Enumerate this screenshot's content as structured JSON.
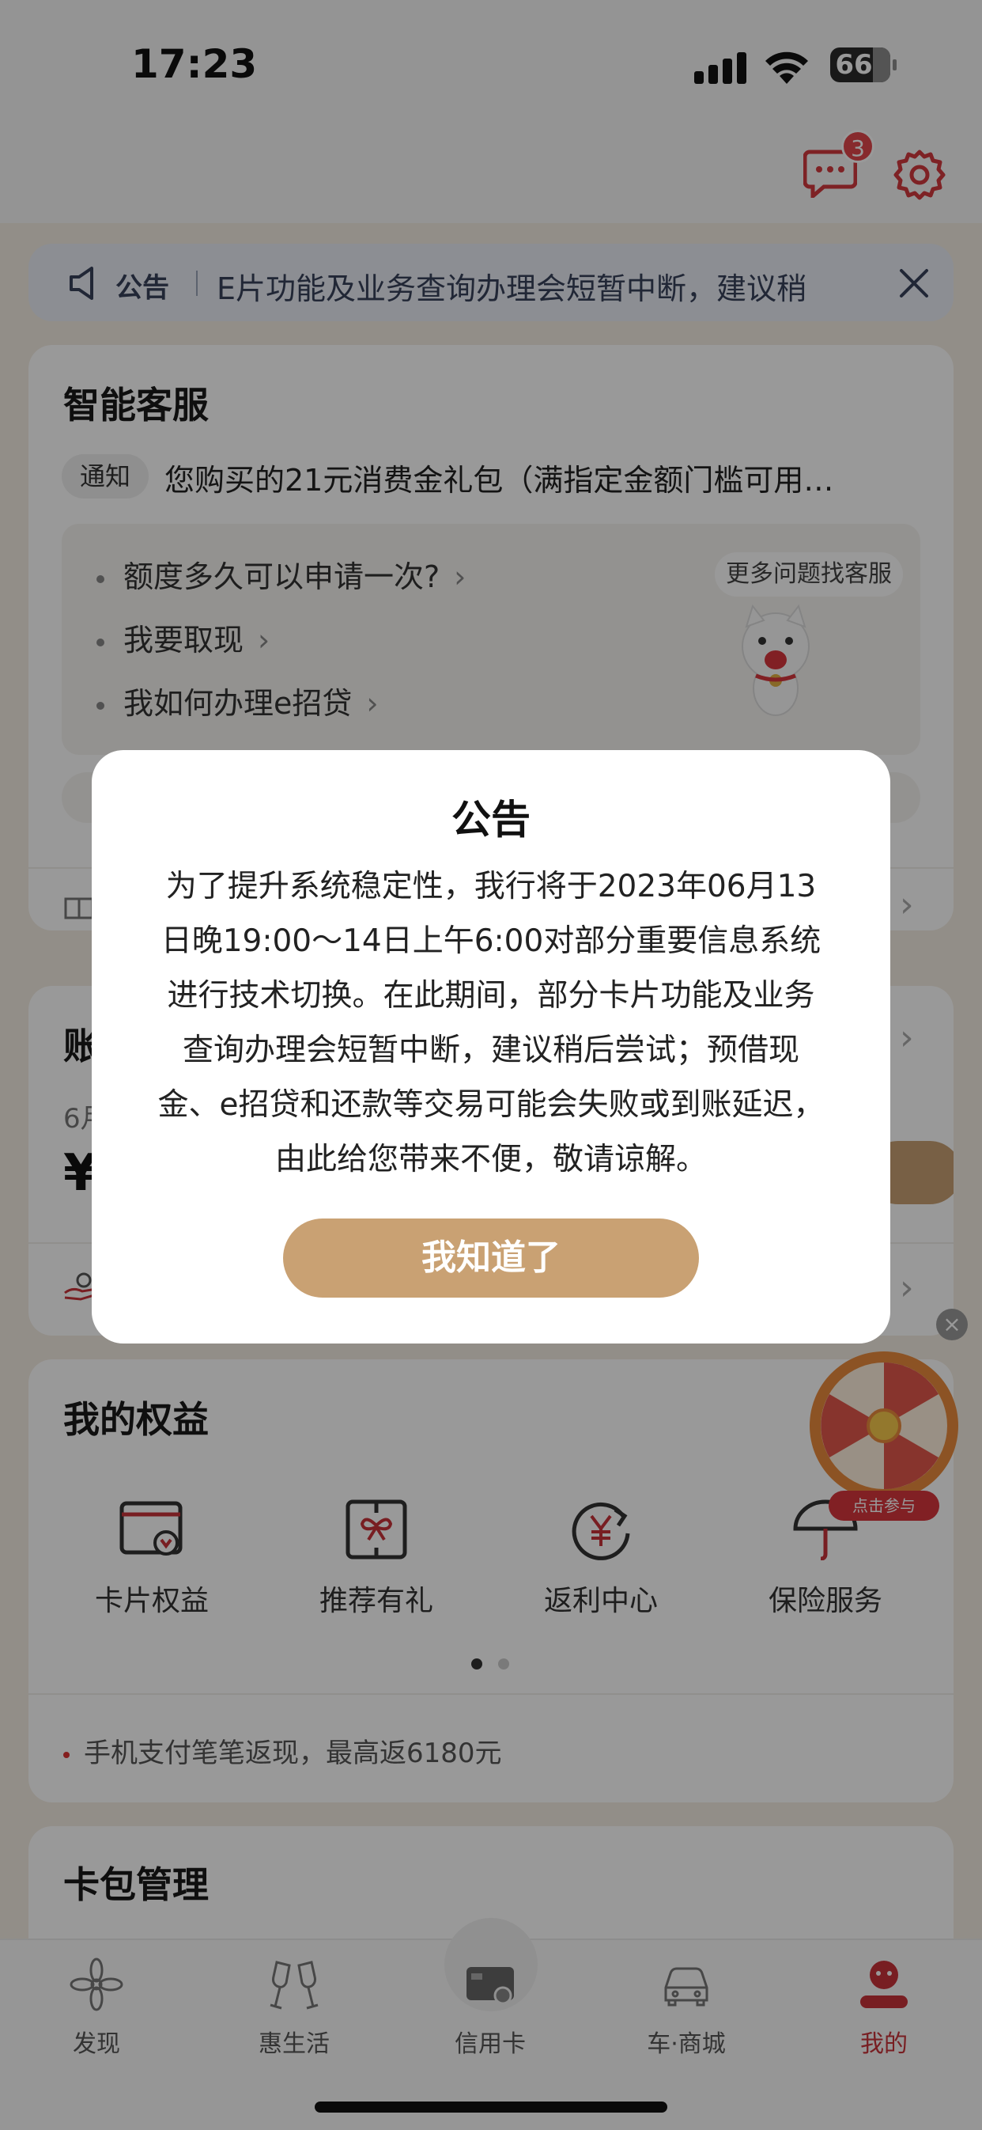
{
  "status_bar": {
    "time": "17:23",
    "battery": "66"
  },
  "header": {
    "message_badge": "3"
  },
  "notice_bar": {
    "label": "公告",
    "text": "E片功能及业务查询办理会短暂中断，建议稍"
  },
  "smart_service": {
    "title": "智能客服",
    "tag": "通知",
    "notice": "您购买的21元消费金礼包（满指定金额门槛可用…",
    "faq": [
      {
        "label": "额度多久可以申请一次?"
      },
      {
        "label": "我要取现"
      },
      {
        "label": "我如何办理e招贷"
      }
    ],
    "more_label": "更多问题找客服"
  },
  "bill": {
    "title_partial": "账",
    "date_partial": "6月",
    "amount_partial": "¥"
  },
  "benefits": {
    "title": "我的权益",
    "items": [
      {
        "label": "卡片权益",
        "icon": "card-benefit-icon"
      },
      {
        "label": "推荐有礼",
        "icon": "gift-ribbon-icon"
      },
      {
        "label": "返利中心",
        "icon": "yuan-refresh-icon"
      },
      {
        "label": "保险服务",
        "icon": "umbrella-icon"
      }
    ],
    "promo": "手机支付笔笔返现，最高返6180元"
  },
  "card_package": {
    "title": "卡包管理"
  },
  "wheel": {
    "label": "点击参与"
  },
  "tabbar": {
    "tabs": [
      {
        "label": "发现",
        "icon": "flower-icon"
      },
      {
        "label": "惠生活",
        "icon": "cheers-icon"
      },
      {
        "label": "信用卡",
        "icon": "credit-card-icon"
      },
      {
        "label": "车·商城",
        "icon": "car-icon"
      },
      {
        "label": "我的",
        "icon": "profile-icon",
        "active": true
      }
    ]
  },
  "modal": {
    "title": "公告",
    "lines": [
      "为了提升系统稳定性，我行将于2023年06月13",
      "日晚19:00～14日上午6:00对部分重要信息系统",
      "进行技术切换。在此期间，部分卡片功能及业务",
      "查询办理会短暂中断，建议稍后尝试；预借现",
      "金、e招贷和还款等交易可能会失败或到账延迟，",
      "由此给您带来不便，敬请谅解。"
    ],
    "button": "我知道了"
  },
  "colors": {
    "accent": "#c9a173",
    "active_tab": "#c9333a",
    "badge": "#e2474b",
    "notice_bg": "#e9edf5"
  }
}
